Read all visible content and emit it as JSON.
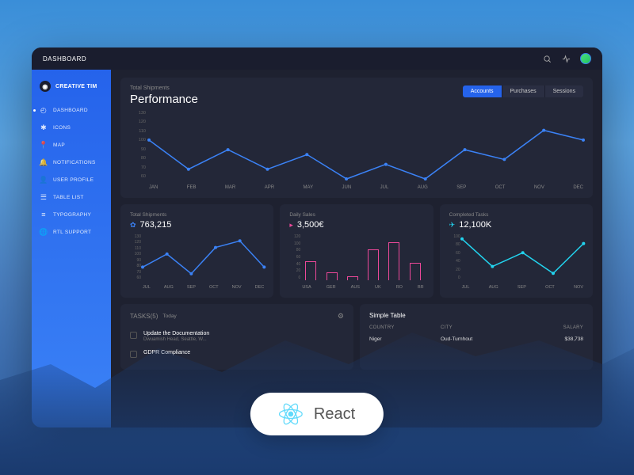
{
  "topbar": {
    "title": "DASHBOARD"
  },
  "brand": {
    "name": "CREATIVE TIM"
  },
  "sidebar": {
    "items": [
      {
        "label": "DASHBOARD"
      },
      {
        "label": "ICONS"
      },
      {
        "label": "MAP"
      },
      {
        "label": "NOTIFICATIONS"
      },
      {
        "label": "USER PROFILE"
      },
      {
        "label": "TABLE LIST"
      },
      {
        "label": "TYPOGRAPHY"
      },
      {
        "label": "RTL SUPPORT"
      }
    ]
  },
  "hero": {
    "subtitle": "Total Shipments",
    "title": "Performance",
    "tabs": [
      {
        "label": "Accounts"
      },
      {
        "label": "Purchases"
      },
      {
        "label": "Sessions"
      }
    ]
  },
  "mini": [
    {
      "label": "Total Shipments",
      "value": "763,215",
      "color": "#3b82f6"
    },
    {
      "label": "Daily Sales",
      "value": "3,500€",
      "color": "#ec4899"
    },
    {
      "label": "Completed Tasks",
      "value": "12,100K",
      "color": "#22d3ee"
    }
  ],
  "tasks": {
    "title": "TASKS(5)",
    "filter": "Today",
    "items": [
      {
        "title": "Update the Documentation",
        "sub": "Dwuamish Head, Seattle, W..."
      },
      {
        "title": "GDPR Compliance",
        "sub": ""
      }
    ]
  },
  "table": {
    "title": "Simple Table",
    "headers": {
      "country": "COUNTRY",
      "city": "CITY",
      "salary": "SALARY"
    },
    "rows": [
      {
        "country": "Niger",
        "city": "Oud-Turnhout",
        "salary": "$38,738"
      }
    ]
  },
  "badge": {
    "text": "React"
  },
  "chart_data": [
    {
      "type": "line",
      "name": "performance",
      "categories": [
        "JAN",
        "FEB",
        "MAR",
        "APR",
        "MAY",
        "JUN",
        "JUL",
        "AUG",
        "SEP",
        "OCT",
        "NOV",
        "DEC"
      ],
      "values": [
        100,
        70,
        90,
        70,
        85,
        60,
        75,
        60,
        90,
        80,
        110,
        100
      ],
      "ylim": [
        60,
        130
      ],
      "y_ticks": [
        60,
        70,
        80,
        90,
        100,
        110,
        120,
        130
      ],
      "color": "#3b82f6"
    },
    {
      "type": "line",
      "name": "total-shipments-mini",
      "categories": [
        "JUL",
        "AUG",
        "SEP",
        "OCT",
        "NOV",
        "DEC"
      ],
      "values": [
        80,
        100,
        70,
        110,
        120,
        80
      ],
      "ylim": [
        60,
        130
      ],
      "color": "#3b82f6"
    },
    {
      "type": "bar",
      "name": "daily-sales",
      "categories": [
        "USA",
        "GER",
        "AUS",
        "UK",
        "RO",
        "BR"
      ],
      "values": [
        50,
        20,
        10,
        80,
        100,
        45
      ],
      "ylim": [
        0,
        120
      ],
      "color": "#ec4899"
    },
    {
      "type": "line",
      "name": "completed-tasks",
      "categories": [
        "JUL",
        "AUG",
        "SEP",
        "OCT",
        "NOV"
      ],
      "values": [
        90,
        30,
        60,
        15,
        80
      ],
      "ylim": [
        0,
        100
      ],
      "color": "#22d3ee"
    }
  ]
}
